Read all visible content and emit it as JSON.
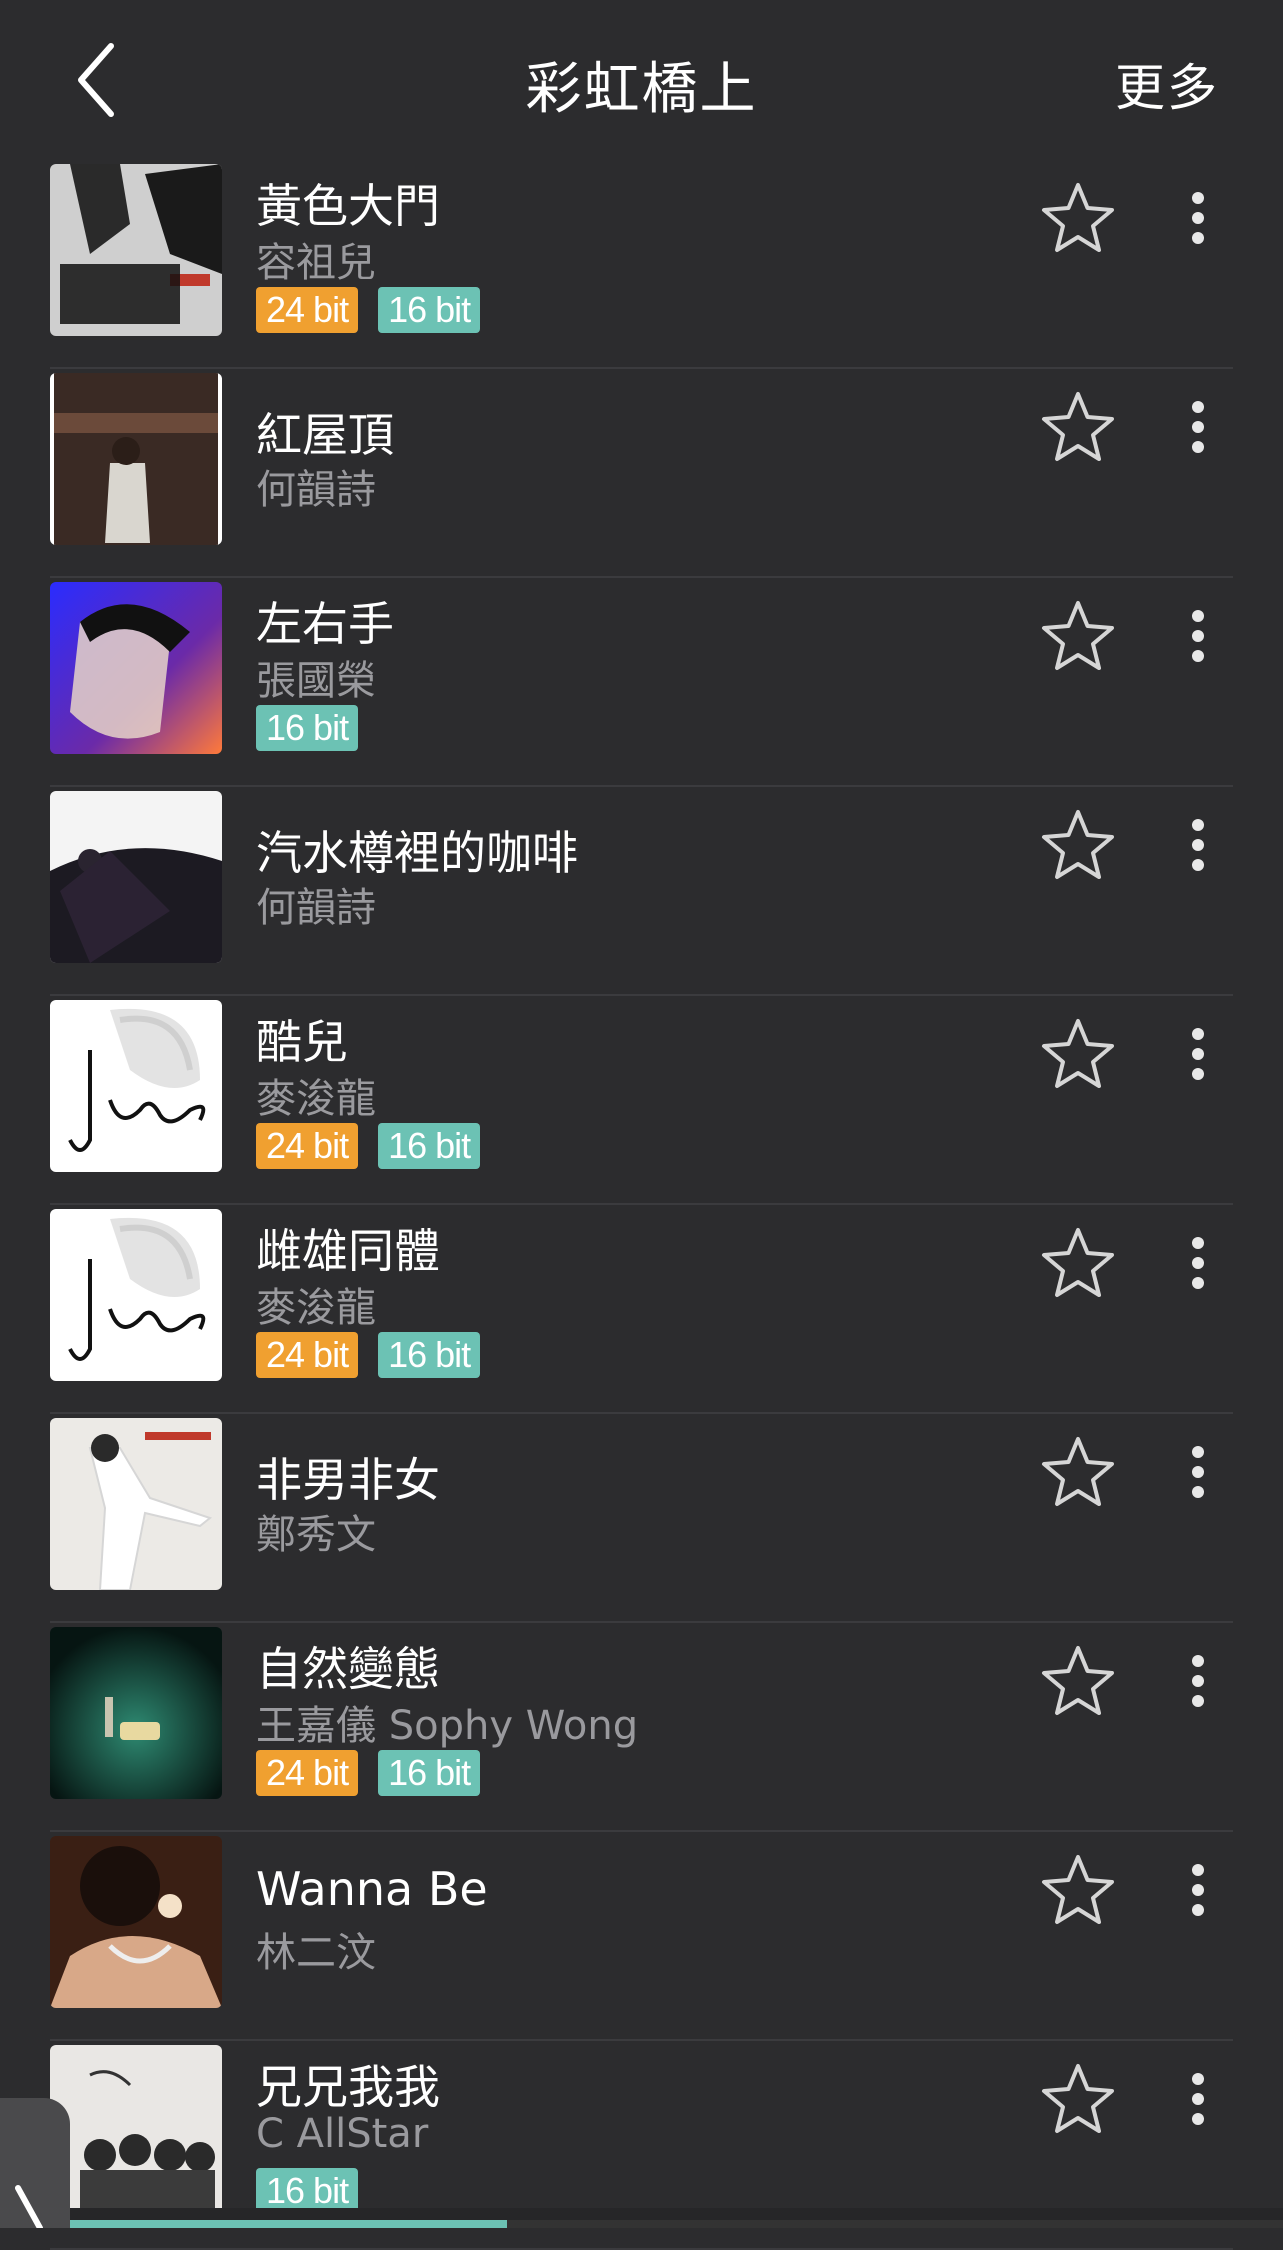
{
  "header": {
    "title": "彩虹橋上",
    "more_label": "更多"
  },
  "colors": {
    "background": "#2c2c2e",
    "tag_24bit": "#f0a030",
    "tag_16bit": "#6cc2b4",
    "artist_text": "#9a9a9e"
  },
  "songs": [
    {
      "title": "黃色大門",
      "artist": "容祖兒",
      "tags": [
        "24 bit",
        "16 bit"
      ]
    },
    {
      "title": "紅屋頂",
      "artist": "何韻詩",
      "tags": []
    },
    {
      "title": "左右手",
      "artist": "張國榮",
      "tags": [
        "16 bit"
      ]
    },
    {
      "title": "汽水樽裡的咖啡",
      "artist": "何韻詩",
      "tags": []
    },
    {
      "title": "酷兒",
      "artist": "麥浚龍",
      "tags": [
        "24 bit",
        "16 bit"
      ]
    },
    {
      "title": "雌雄同體",
      "artist": "麥浚龍",
      "tags": [
        "24 bit",
        "16 bit"
      ]
    },
    {
      "title": "非男非女",
      "artist": "鄭秀文",
      "tags": []
    },
    {
      "title": "自然變態",
      "artist": "王嘉儀 Sophy Wong",
      "tags": [
        "24 bit",
        "16 bit"
      ]
    },
    {
      "title": "Wanna Be",
      "artist": "林二汶",
      "tags": []
    },
    {
      "title": "兄兄我我",
      "artist": "C AllStar",
      "tags": [
        "16 bit"
      ]
    }
  ],
  "playback": {
    "progress": 0.36
  }
}
